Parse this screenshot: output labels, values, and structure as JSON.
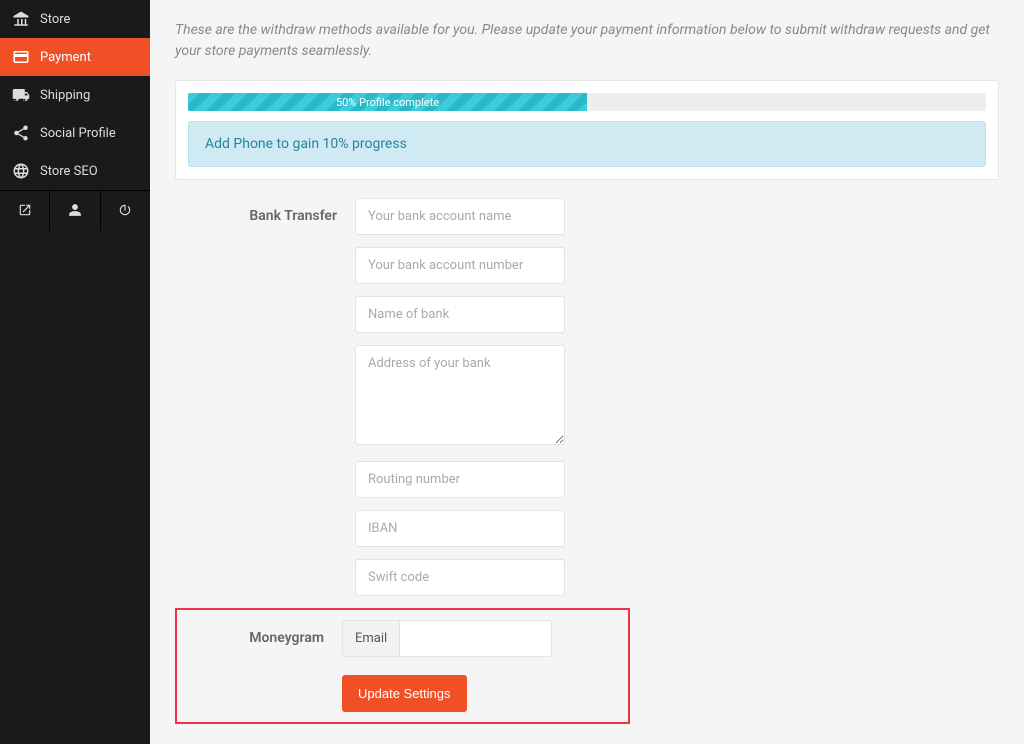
{
  "sidebar": {
    "items": [
      {
        "label": "Store",
        "icon": "bank-icon"
      },
      {
        "label": "Payment",
        "icon": "card-icon"
      },
      {
        "label": "Shipping",
        "icon": "truck-icon"
      },
      {
        "label": "Social Profile",
        "icon": "share-icon"
      },
      {
        "label": "Store SEO",
        "icon": "globe-icon"
      }
    ]
  },
  "description": "These are the withdraw methods available for you. Please update your payment information below to submit withdraw requests and get your store payments seamlessly.",
  "progress": {
    "percent": 50,
    "label": "50% Profile complete"
  },
  "alert": "Add Phone to gain 10% progress",
  "bank": {
    "section_label": "Bank Transfer",
    "placeholders": {
      "account_name": "Your bank account name",
      "account_number": "Your bank account number",
      "bank_name": "Name of bank",
      "bank_address": "Address of your bank",
      "routing": "Routing number",
      "iban": "IBAN",
      "swift": "Swift code"
    }
  },
  "moneygram": {
    "section_label": "Moneygram",
    "addon": "Email"
  },
  "submit_label": "Update Settings"
}
